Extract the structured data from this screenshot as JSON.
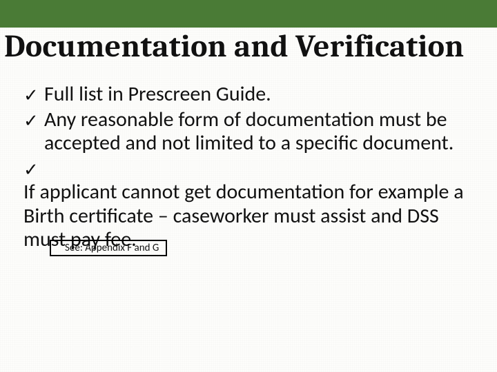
{
  "colors": {
    "topbar": "#4a7b36"
  },
  "title": "Documentation and Verification",
  "bullets": [
    "Full list in Prescreen Guide.",
    "Any reasonable form of documentation must be accepted and not limited to a specific document.",
    "If applicant cannot get documentation for example a Birth certificate – caseworker must assist and DSS must pay fee."
  ],
  "bullet_glyph": "✓",
  "reference_box": "See: Appendix F and G"
}
